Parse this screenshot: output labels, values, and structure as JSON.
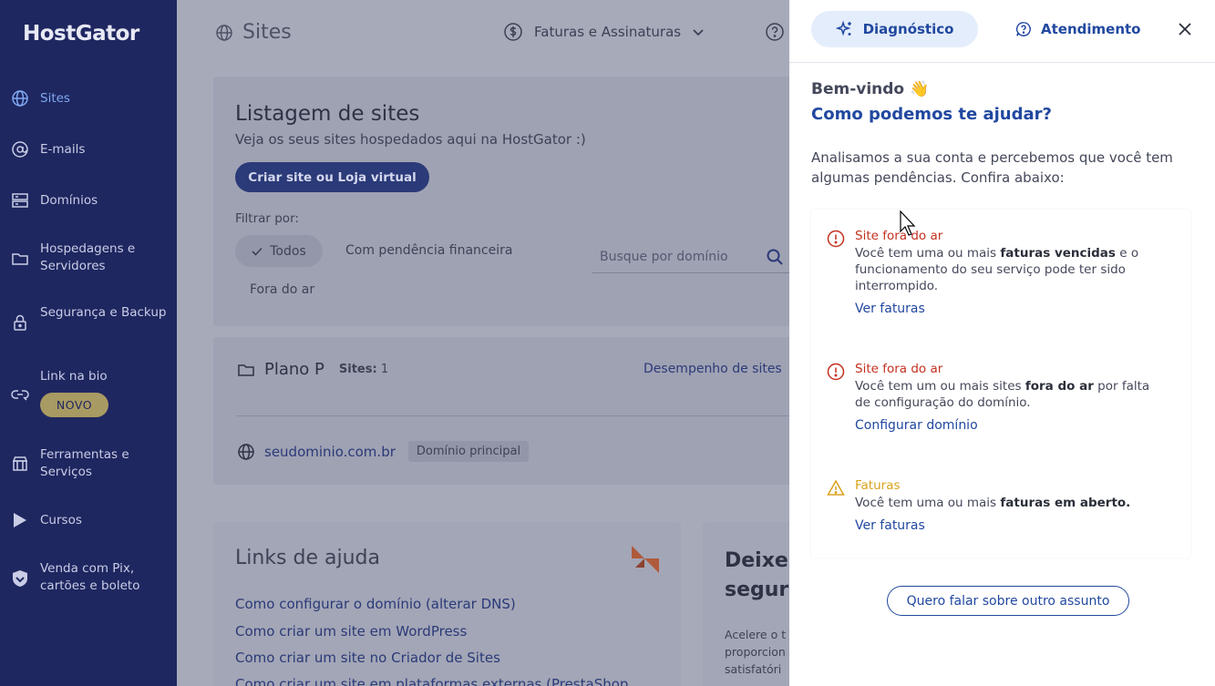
{
  "sidebar": {
    "logo": "HostGator",
    "items": [
      {
        "label": "Sites",
        "icon": "globe-icon",
        "active": true
      },
      {
        "label": "E-mails",
        "icon": "at-icon"
      },
      {
        "label": "Domínios",
        "icon": "server-icon"
      },
      {
        "label": "Hospedagens e Servidores",
        "icon": "folder-icon"
      },
      {
        "label": "Segurança e Backup",
        "icon": "lock-icon"
      },
      {
        "label": "Link na bio",
        "icon": "link-icon"
      },
      {
        "label": "Ferramentas e Serviços",
        "icon": "store-icon"
      },
      {
        "label": "Cursos",
        "icon": "play-icon"
      },
      {
        "label": "Venda com Pix, cartões e boleto",
        "icon": "shield-icon"
      }
    ],
    "badge_new": "NOVO"
  },
  "topbar": {
    "title": "Sites",
    "billing": "Faturas e Assinaturas"
  },
  "listing": {
    "title": "Listagem de sites",
    "subtitle": "Veja os seus sites hospedados aqui na HostGator :)",
    "create_button": "Criar site ou Loja virtual",
    "filter_label": "Filtrar por:",
    "filters": [
      "Todos",
      "Com pendência financeira",
      "Fora do ar"
    ],
    "search_placeholder": "Busque por domínio"
  },
  "plan": {
    "name": "Plano P",
    "sites_label": "Sites:",
    "sites_count": "1",
    "performance_link": "Desempenho de sites",
    "domain": "seudominio.com.br",
    "domain_tag": "Domínio principal"
  },
  "help_links": {
    "title": "Links de ajuda",
    "links": [
      "Como configurar o domínio (alterar DNS)",
      "Como criar um site em WordPress",
      "Como criar um site no Criador de Sites",
      "Como criar um site em plataformas externas (PrestaShop"
    ]
  },
  "promo": {
    "title_line1": "Deixe",
    "title_line2": "segur",
    "text_line1": "Acelere o t",
    "text_line2": "proporcion",
    "text_line3": "satisfatóri"
  },
  "panel": {
    "tab_diagnostic": "Diagnóstico",
    "tab_support": "Atendimento",
    "welcome": "Bem-vindo 👋",
    "question": "Como podemos te ajudar?",
    "intro": "Analisamos a sua conta e percebemos que você tem algumas pendências. Confira abaixo:",
    "alerts": [
      {
        "title": "Site fora do ar",
        "text_pre": "Você tem uma ou mais ",
        "text_bold": "faturas vencidas",
        "text_post": " e o funcionamento do seu serviço pode ter sido interrompido.",
        "link": "Ver faturas",
        "level": "error"
      },
      {
        "title": "Site fora do ar",
        "text_pre": "Você tem um ou mais sites ",
        "text_bold": "fora do ar",
        "text_post": " por falta de configuração do domínio.",
        "link": "Configurar domínio",
        "level": "error"
      },
      {
        "title": "Faturas",
        "text_pre": "Você tem uma ou mais ",
        "text_bold": "faturas em aberto.",
        "text_post": "",
        "link": "Ver faturas",
        "level": "warning"
      }
    ],
    "other_subject_button": "Quero falar sobre outro assunto"
  },
  "colors": {
    "sidebar_bg": "#1f2760",
    "accent": "#2148a0",
    "error": "#c4311f",
    "warning": "#d9a21b"
  }
}
